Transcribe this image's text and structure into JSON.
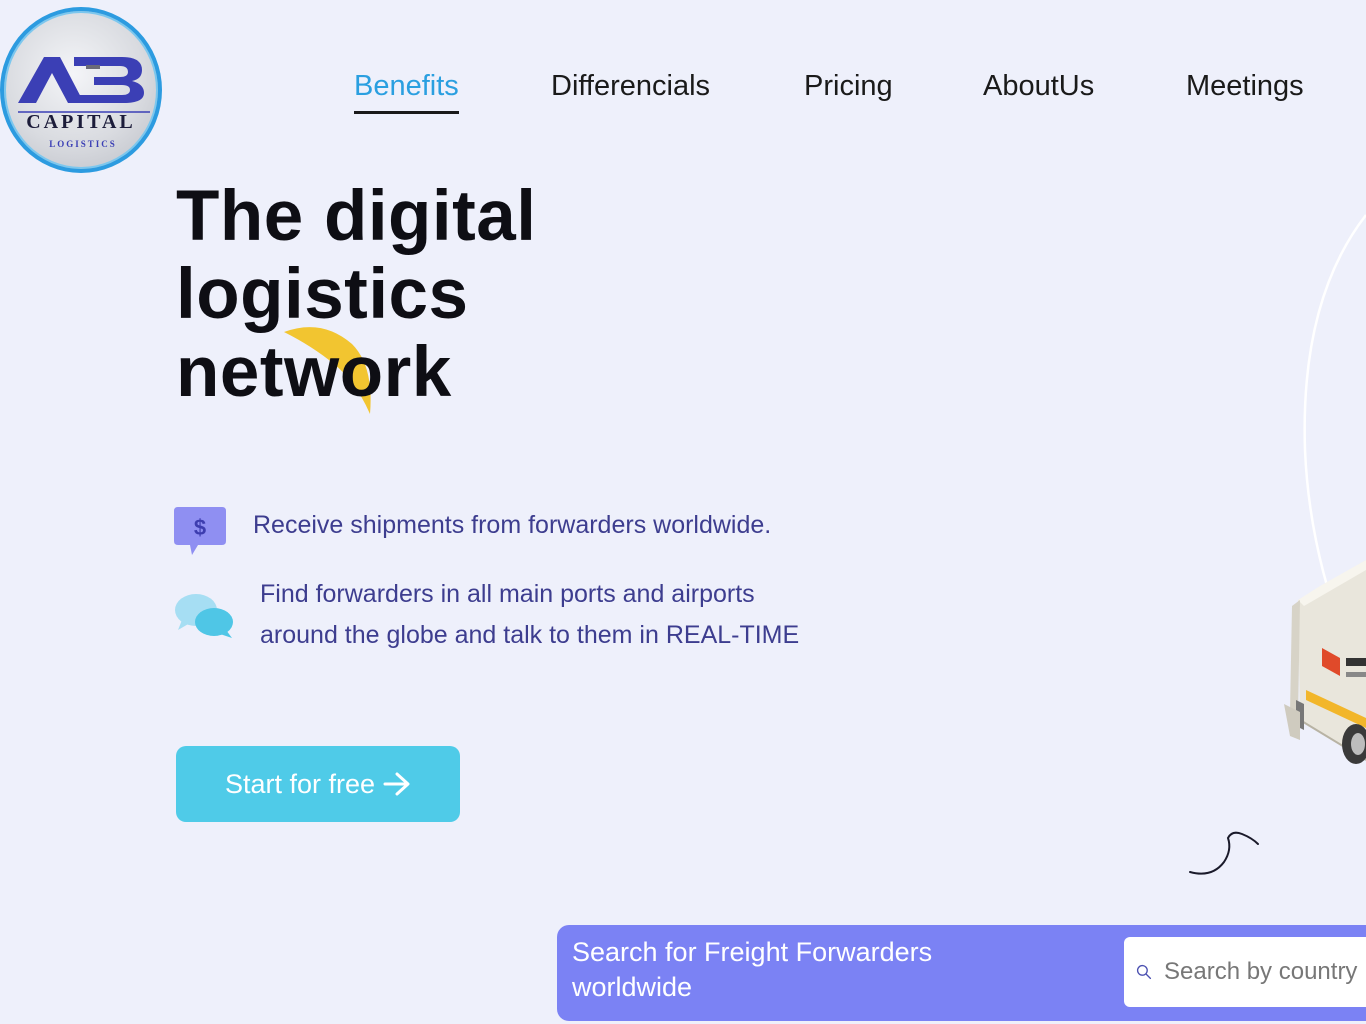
{
  "brand": {
    "logo_text_top": "AB",
    "logo_text_middle": "CAPITAL",
    "logo_text_bottom": "LOGISTICS",
    "colors": {
      "ring": "#2c9be0",
      "letters": "#3b3fb5"
    }
  },
  "nav": {
    "items": [
      {
        "label": "Benefits",
        "active": true
      },
      {
        "label": "Differencials",
        "active": false
      },
      {
        "label": "Pricing",
        "active": false
      },
      {
        "label": "AboutUs",
        "active": false
      },
      {
        "label": "Meetings",
        "active": false
      }
    ]
  },
  "hero": {
    "title_line_1": "The digital",
    "title_line_2": "logistics",
    "title_line_3": "network"
  },
  "features": [
    {
      "icon": "dollar-chat-icon",
      "text": "Receive shipments from forwarders worldwide."
    },
    {
      "icon": "chat-bubbles-icon",
      "text_line_1": "Find forwarders in all main ports and airports",
      "text_line_2": "around the globe and talk to them in REAL-TIME"
    }
  ],
  "cta": {
    "label": "Start for free",
    "icon": "arrow-right-icon",
    "color": "#4fcbe8"
  },
  "search": {
    "title_line_1": "Search for Freight Forwarders",
    "title_line_2": "worldwide",
    "placeholder": "Search by country",
    "panel_color": "#7b82f4"
  }
}
